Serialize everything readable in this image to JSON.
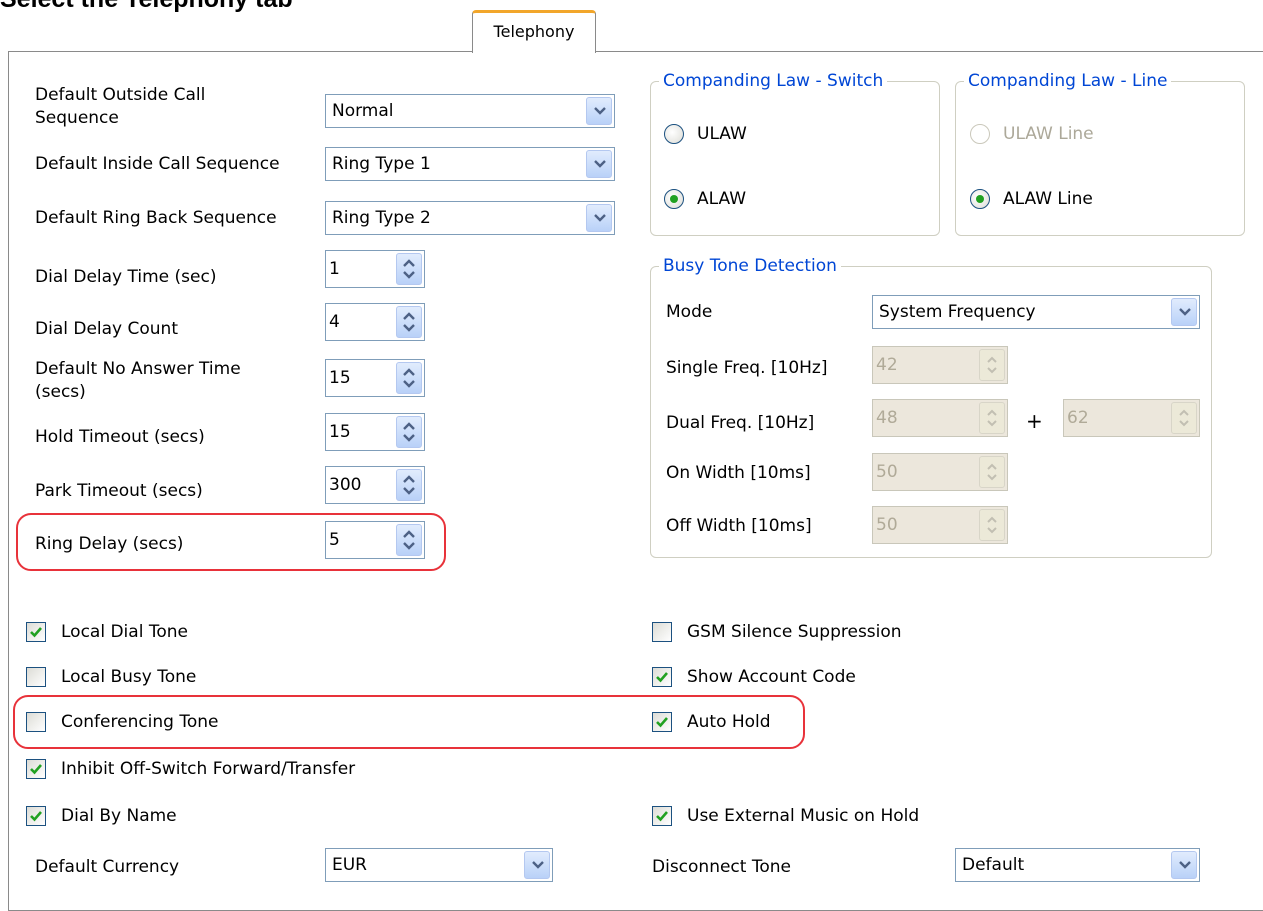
{
  "header": {
    "partial_title": "Select the Telephony tab"
  },
  "tab": {
    "label": "Telephony"
  },
  "left": {
    "outside_call": {
      "label": "Default Outside Call Sequence",
      "value": "Normal"
    },
    "inside_call": {
      "label": "Default Inside Call Sequence",
      "value": "Ring Type 1"
    },
    "ring_back": {
      "label": "Default Ring Back Sequence",
      "value": "Ring Type 2"
    },
    "dial_delay_time": {
      "label": "Dial Delay Time (sec)",
      "value": "1"
    },
    "dial_delay_count": {
      "label": "Dial Delay Count",
      "value": "4"
    },
    "no_answer_time": {
      "label": "Default No Answer Time (secs)",
      "value": "15"
    },
    "hold_timeout": {
      "label": "Hold Timeout (secs)",
      "value": "15"
    },
    "park_timeout": {
      "label": "Park Timeout (secs)",
      "value": "300"
    },
    "ring_delay": {
      "label": "Ring Delay (secs)",
      "value": "5"
    }
  },
  "companding_switch": {
    "legend": "Companding Law - Switch",
    "ulaw": "ULAW",
    "alaw": "ALAW",
    "selected": "ALAW"
  },
  "companding_line": {
    "legend": "Companding Law - Line",
    "ulaw": "ULAW Line",
    "alaw": "ALAW Line",
    "selected": "ALAW Line"
  },
  "busy_tone": {
    "legend": "Busy Tone Detection",
    "mode": {
      "label": "Mode",
      "value": "System Frequency"
    },
    "single_freq": {
      "label": "Single Freq. [10Hz]",
      "value": "42"
    },
    "dual_freq": {
      "label": "Dual Freq. [10Hz]",
      "value1": "48",
      "plus": "+",
      "value2": "62"
    },
    "on_width": {
      "label": "On Width [10ms]",
      "value": "50"
    },
    "off_width": {
      "label": "Off Width [10ms]",
      "value": "50"
    }
  },
  "checkboxes": {
    "local_dial_tone": {
      "label": "Local Dial Tone",
      "checked": true
    },
    "local_busy_tone": {
      "label": "Local Busy Tone",
      "checked": false
    },
    "conferencing_tone": {
      "label": "Conferencing Tone",
      "checked": false
    },
    "inhibit_off_switch": {
      "label": "Inhibit Off-Switch Forward/Transfer",
      "checked": true
    },
    "dial_by_name": {
      "label": "Dial By Name",
      "checked": true
    },
    "gsm_silence": {
      "label": "GSM Silence Suppression",
      "checked": false
    },
    "show_account_code": {
      "label": "Show Account Code",
      "checked": true
    },
    "auto_hold": {
      "label": "Auto Hold",
      "checked": true
    },
    "external_moh": {
      "label": "Use External Music on Hold",
      "checked": true
    }
  },
  "bottom": {
    "currency": {
      "label": "Default Currency",
      "value": "EUR"
    },
    "disconnect_tone": {
      "label": "Disconnect Tone",
      "value": "Default"
    }
  },
  "colors": {
    "accent_tab": "#f2a62a",
    "legend": "#0046d5",
    "highlight": "#e8323a",
    "check": "#21a121"
  }
}
